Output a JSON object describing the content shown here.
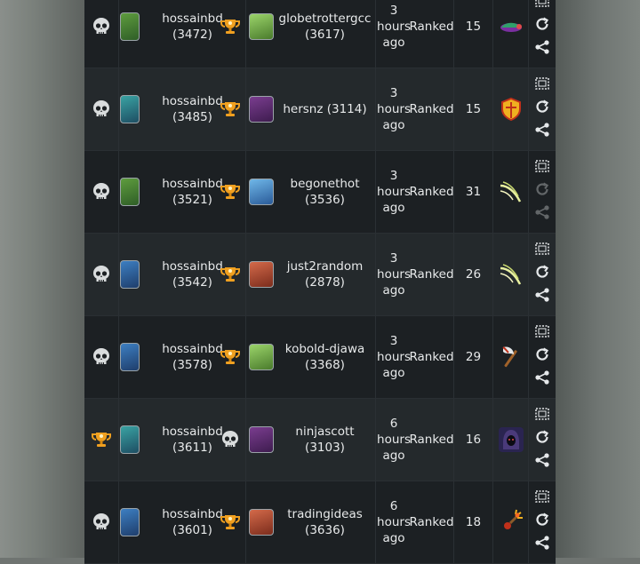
{
  "colors": {
    "accent": "#e5e8ea",
    "trophy": "#f0a020",
    "row_odd": "#1c2023",
    "row_even": "#24292c"
  },
  "rows": [
    {
      "result1": "skull-icon",
      "p1_name": "hossainbd",
      "p1_rating": "(3472)",
      "result2": "trophy-icon",
      "p2_name": "globetrottergcc",
      "p2_rating": "(3617)",
      "time": [
        "3",
        "hours",
        "ago"
      ],
      "mode": "Ranked",
      "turns": "15",
      "card": "crystal-card-icon",
      "p1_avatar": "av-green",
      "p2_avatar": "av-lime"
    },
    {
      "result1": "skull-icon",
      "p1_name": "hossainbd",
      "p1_rating": "(3485)",
      "result2": "trophy-icon",
      "p2_name": "hersnz (3114)",
      "p2_rating": "",
      "time": [
        "3",
        "hours",
        "ago"
      ],
      "mode": "Ranked",
      "turns": "15",
      "card": "shield-card-icon",
      "p1_avatar": "av-teal",
      "p2_avatar": "av-purple"
    },
    {
      "result1": "skull-icon",
      "p1_name": "hossainbd",
      "p1_rating": "(3521)",
      "result2": "trophy-icon",
      "p2_name": "begonethot",
      "p2_rating": "(3536)",
      "time": [
        "3",
        "hours",
        "ago"
      ],
      "mode": "Ranked",
      "turns": "31",
      "card": "slash-card-icon",
      "p1_avatar": "av-green",
      "p2_avatar": "av-sky"
    },
    {
      "result1": "skull-icon",
      "p1_name": "hossainbd",
      "p1_rating": "(3542)",
      "result2": "trophy-icon",
      "p2_name": "just2random",
      "p2_rating": "(2878)",
      "time": [
        "3",
        "hours",
        "ago"
      ],
      "mode": "Ranked",
      "turns": "26",
      "card": "slash-card-icon",
      "p1_avatar": "av-blue",
      "p2_avatar": "av-red"
    },
    {
      "result1": "skull-icon",
      "p1_name": "hossainbd",
      "p1_rating": "(3578)",
      "result2": "trophy-icon",
      "p2_name": "kobold-djawa",
      "p2_rating": "(3368)",
      "time": [
        "3",
        "hours",
        "ago"
      ],
      "mode": "Ranked",
      "turns": "29",
      "card": "axe-card-icon",
      "p1_avatar": "av-blue",
      "p2_avatar": "av-lime"
    },
    {
      "result1": "trophy-icon",
      "p1_name": "hossainbd",
      "p1_rating": "(3611)",
      "result2": "skull-icon",
      "p2_name": "ninjascott (3103)",
      "p2_rating": "",
      "time": [
        "6",
        "hours",
        "ago"
      ],
      "mode": "Ranked",
      "turns": "16",
      "card": "hood-card-icon",
      "p1_avatar": "av-teal",
      "p2_avatar": "av-purple"
    },
    {
      "result1": "skull-icon",
      "p1_name": "hossainbd",
      "p1_rating": "(3601)",
      "result2": "trophy-icon",
      "p2_name": "tradingideas",
      "p2_rating": "(3636)",
      "time": [
        "6",
        "hours",
        "ago"
      ],
      "mode": "Ranked",
      "turns": "18",
      "card": "bomb-card-icon",
      "p1_avatar": "av-blue",
      "p2_avatar": "av-red"
    }
  ]
}
